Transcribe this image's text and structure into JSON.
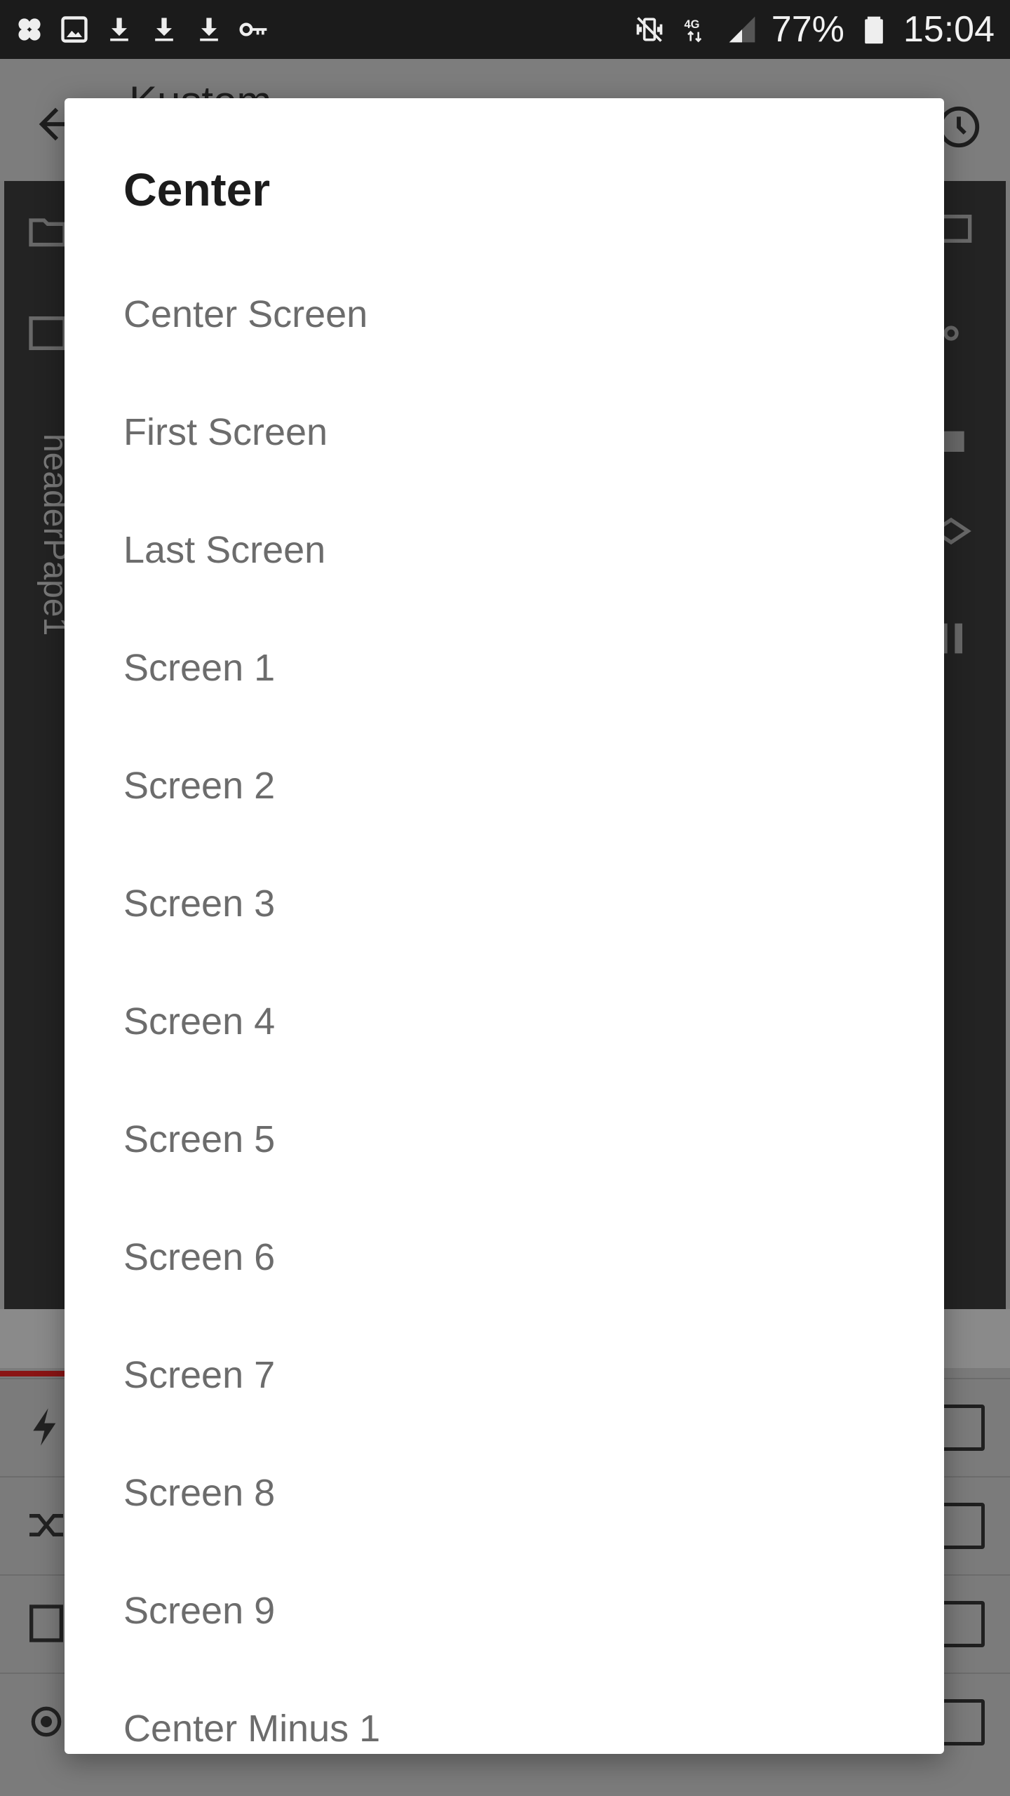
{
  "status_bar": {
    "battery": "77%",
    "time": "15:04",
    "network": "4G",
    "icons_left": [
      "clover-icon",
      "image-icon",
      "download-icon",
      "download-icon",
      "download-icon",
      "key-icon"
    ],
    "icons_right": [
      "vibrate-mute-icon",
      "network-4g-icon",
      "signal-icon",
      "battery-icon"
    ]
  },
  "background_app": {
    "title": "Kustom",
    "vertical_label": "headerPape1"
  },
  "dialog": {
    "title": "Center",
    "options": [
      "Center Screen",
      "First Screen",
      "Last Screen",
      "Screen 1",
      "Screen 2",
      "Screen 3",
      "Screen 4",
      "Screen 5",
      "Screen 6",
      "Screen 7",
      "Screen 8",
      "Screen 9",
      "Center Minus 1"
    ]
  }
}
